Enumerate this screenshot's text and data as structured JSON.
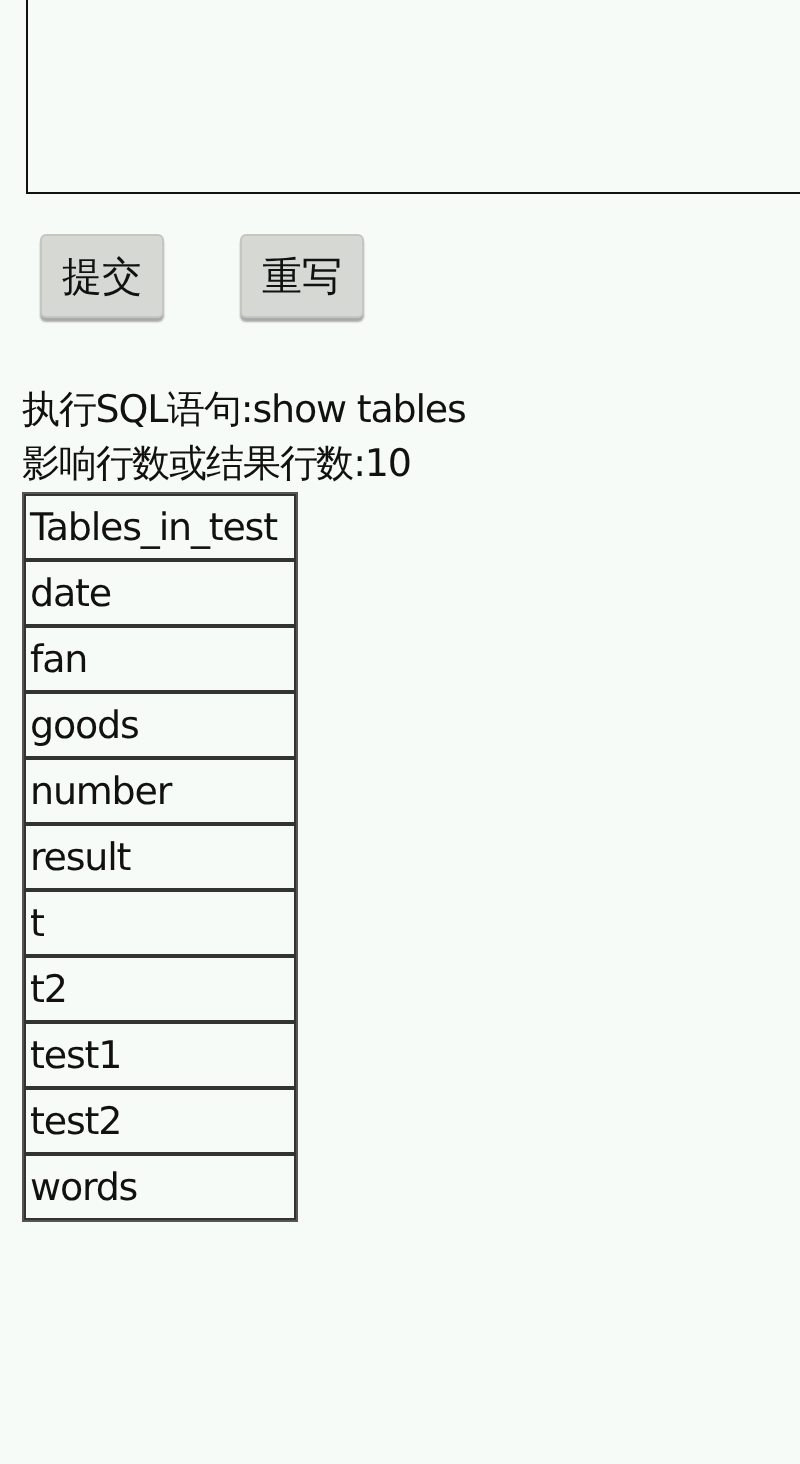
{
  "buttons": [
    {
      "label": "提交"
    },
    {
      "label": "重写"
    }
  ],
  "executed_sql": "执行SQL语句:show tables",
  "affected_rows": "影响行数或结果行数:10",
  "table": {
    "columns": [
      "Tables_in_test"
    ],
    "rows": [
      [
        "date"
      ],
      [
        "fan"
      ],
      [
        "goods"
      ],
      [
        "number"
      ],
      [
        "result"
      ],
      [
        "t"
      ],
      [
        "t2"
      ],
      [
        "test1"
      ],
      [
        "test2"
      ],
      [
        "words"
      ]
    ]
  }
}
